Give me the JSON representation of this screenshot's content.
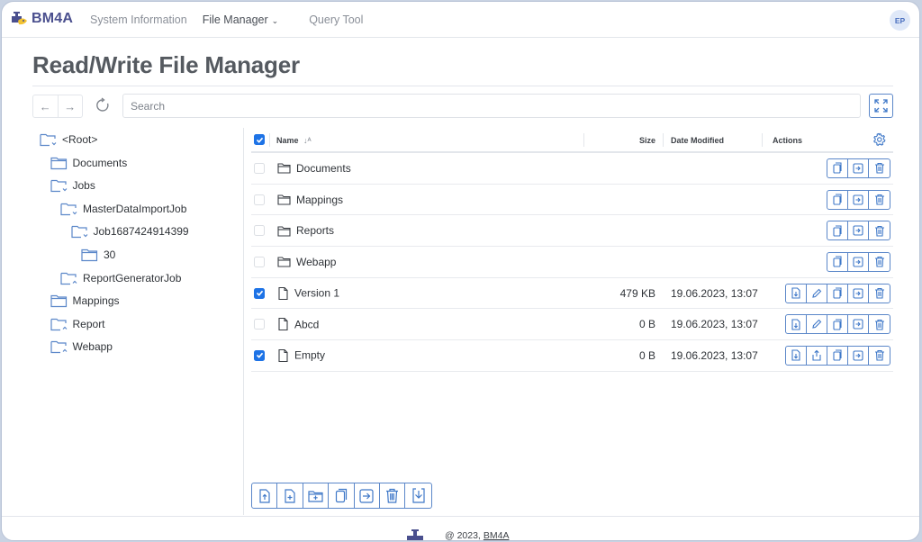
{
  "app": {
    "brand": "BM4A",
    "nav": [
      {
        "label": "System Information",
        "active": false
      },
      {
        "label": "File Manager",
        "active": true,
        "has_dropdown": true
      },
      {
        "label": "Query Tool",
        "active": false
      }
    ],
    "user_initials": "EP",
    "colors": {
      "accent": "#1e73e6",
      "action_border": "#5b87c9",
      "brand": "#4a4f8e"
    }
  },
  "page": {
    "title": "Read/Write File Manager",
    "search_placeholder": "Search",
    "search_value": ""
  },
  "tree": [
    {
      "label": "<Root>",
      "level": 0,
      "state": "expanded"
    },
    {
      "label": "Documents",
      "level": 1,
      "state": "leaf"
    },
    {
      "label": "Jobs",
      "level": 1,
      "state": "expanded"
    },
    {
      "label": "MasterDataImportJob",
      "level": 2,
      "state": "expanded"
    },
    {
      "label": "Job1687424914399",
      "level": 3,
      "state": "expanded"
    },
    {
      "label": "30",
      "level": 4,
      "state": "leaf"
    },
    {
      "label": "ReportGeneratorJob",
      "level": 2,
      "state": "collapsed"
    },
    {
      "label": "Mappings",
      "level": 1,
      "state": "leaf"
    },
    {
      "label": "Report",
      "level": 1,
      "state": "collapsed"
    },
    {
      "label": "Webapp",
      "level": 1,
      "state": "collapsed"
    }
  ],
  "grid": {
    "header_checked": true,
    "columns": {
      "name": "Name",
      "size": "Size",
      "date": "Date Modified",
      "actions": "Actions"
    },
    "rows": [
      {
        "type": "folder",
        "name": "Documents",
        "size": "",
        "date": "",
        "checked": false,
        "actions": [
          "copy",
          "move",
          "delete"
        ]
      },
      {
        "type": "folder",
        "name": "Mappings",
        "size": "",
        "date": "",
        "checked": false,
        "actions": [
          "copy",
          "move",
          "delete"
        ]
      },
      {
        "type": "folder",
        "name": "Reports",
        "size": "",
        "date": "",
        "checked": false,
        "actions": [
          "copy",
          "move",
          "delete"
        ]
      },
      {
        "type": "folder",
        "name": "Webapp",
        "size": "",
        "date": "",
        "checked": false,
        "actions": [
          "copy",
          "move",
          "delete"
        ]
      },
      {
        "type": "file",
        "name": "Version 1",
        "size": "479 KB",
        "date": "19.06.2023, 13:07",
        "checked": true,
        "actions": [
          "download",
          "edit",
          "copy",
          "move",
          "delete"
        ]
      },
      {
        "type": "file",
        "name": "Abcd",
        "size": "0 B",
        "date": "19.06.2023, 13:07",
        "checked": false,
        "actions": [
          "download",
          "edit",
          "copy",
          "move",
          "delete"
        ]
      },
      {
        "type": "file",
        "name": "Empty",
        "size": "0 B",
        "date": "19.06.2023, 13:07",
        "checked": true,
        "actions": [
          "download",
          "share",
          "copy",
          "move",
          "delete"
        ]
      }
    ]
  },
  "bottom_toolbar": [
    "upload-file",
    "new-file",
    "new-folder",
    "copy",
    "move",
    "delete",
    "download"
  ],
  "footer": {
    "copyright": "@ 2023,",
    "link": "BM4A"
  }
}
